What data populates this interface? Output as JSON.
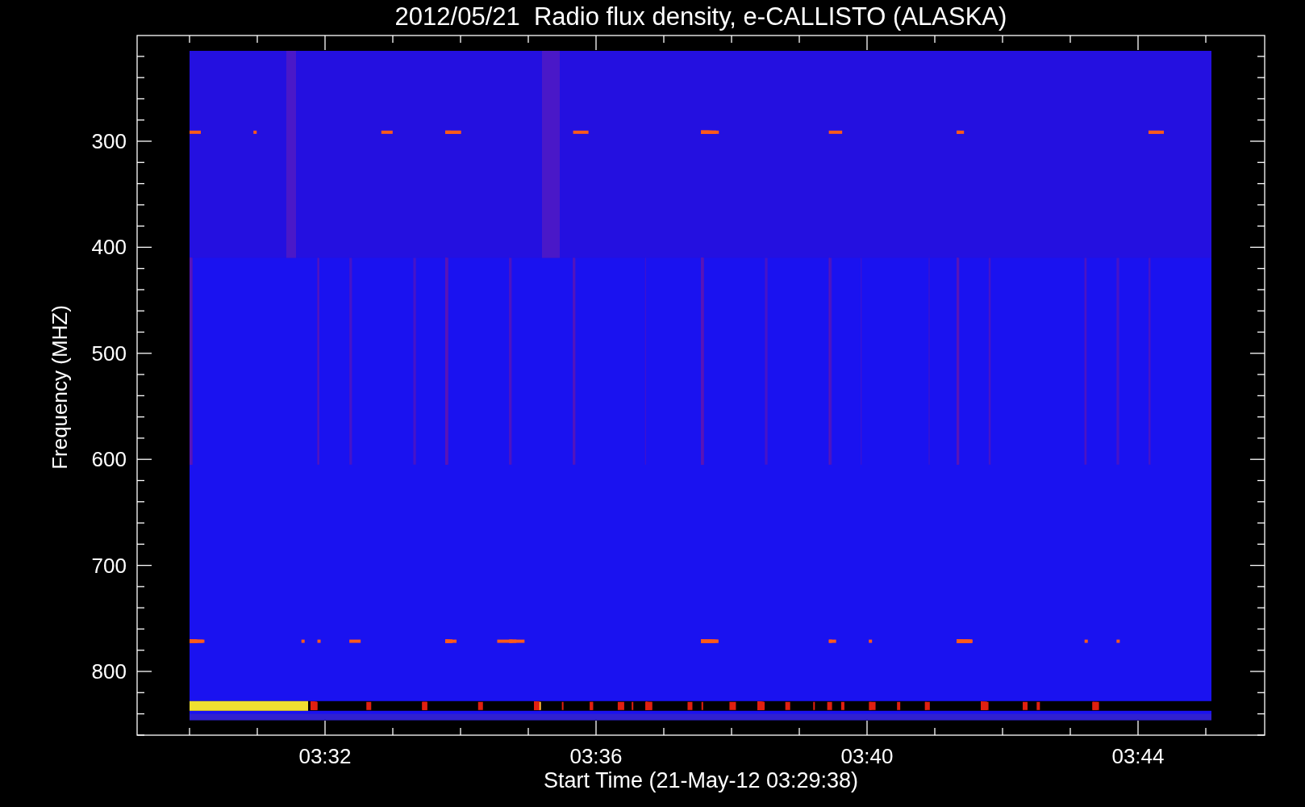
{
  "plot": {
    "title": "2012/05/21  Radio flux density, e-CALLISTO (ALASKA)",
    "ylabel": "Frequency (MHZ)",
    "yticks": [
      "300",
      "400",
      "500",
      "600",
      "700",
      "800"
    ],
    "xticks": [
      "03:32",
      "03:36",
      "03:40",
      "03:44"
    ],
    "xlabel": "Start Time (21-May-12 03:29:38)"
  }
}
